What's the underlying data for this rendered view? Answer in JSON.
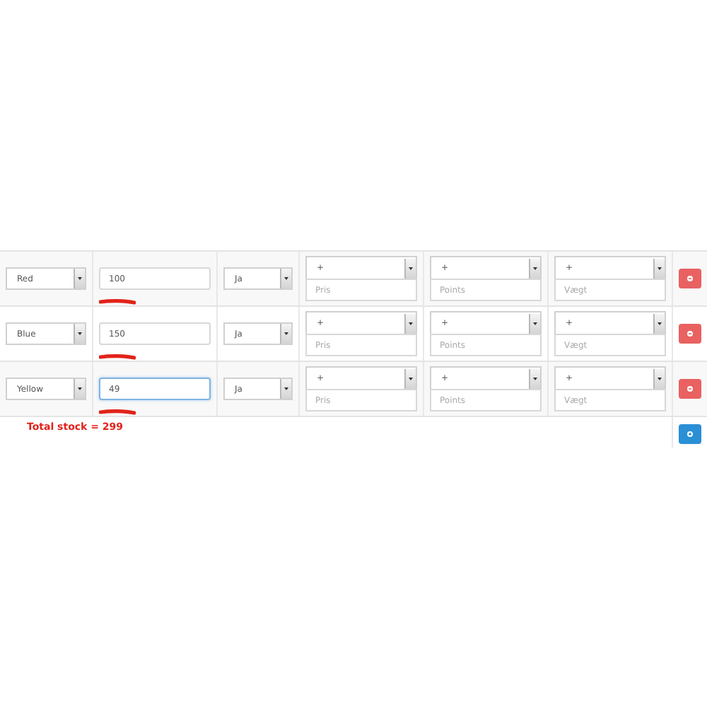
{
  "rows": [
    {
      "option": "Red",
      "quantity": "100",
      "focused": false,
      "marked": true,
      "availability": "Ja",
      "modifiers": [
        {
          "operator": "+",
          "placeholder": "Pris"
        },
        {
          "operator": "+",
          "placeholder": "Points"
        },
        {
          "operator": "+",
          "placeholder": "Vægt"
        }
      ]
    },
    {
      "option": "Blue",
      "quantity": "150",
      "focused": false,
      "marked": true,
      "availability": "Ja",
      "modifiers": [
        {
          "operator": "+",
          "placeholder": "Pris"
        },
        {
          "operator": "+",
          "placeholder": "Points"
        },
        {
          "operator": "+",
          "placeholder": "Vægt"
        }
      ]
    },
    {
      "option": "Yellow",
      "quantity": "49",
      "focused": true,
      "marked": true,
      "availability": "Ja",
      "modifiers": [
        {
          "operator": "+",
          "placeholder": "Pris"
        },
        {
          "operator": "+",
          "placeholder": "Points"
        },
        {
          "operator": "+",
          "placeholder": "Vægt"
        }
      ]
    }
  ],
  "total": "Total stock = 299"
}
